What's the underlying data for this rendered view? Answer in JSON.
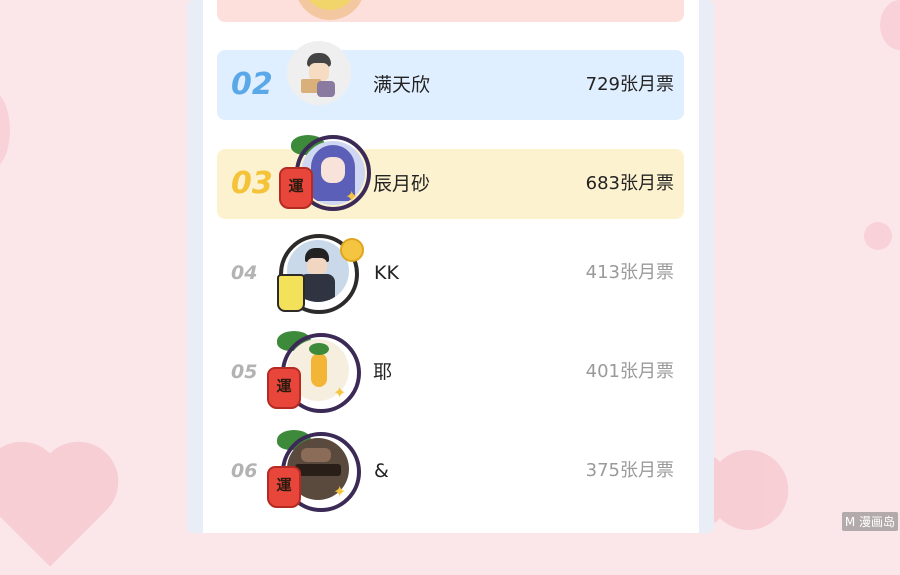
{
  "ranking": [
    {
      "rank": "",
      "name": "",
      "votes": ""
    },
    {
      "rank": "02",
      "name": "满天欣",
      "votes": "729张月票"
    },
    {
      "rank": "03",
      "name": "辰月砂",
      "votes": "683张月票"
    },
    {
      "rank": "04",
      "name": "KK",
      "votes": "413张月票"
    },
    {
      "rank": "05",
      "name": "耶",
      "votes": "401张月票"
    },
    {
      "rank": "06",
      "name": "&",
      "votes": "375张月票"
    }
  ],
  "jar_char": "運",
  "watermark": "M 漫画岛",
  "colors": {
    "rank2": "#5aa8e8",
    "rank3": "#f4c33a",
    "row2_bg": "#e0efff",
    "row3_bg": "#fdf2d0",
    "row1_bg": "#fde0db"
  }
}
